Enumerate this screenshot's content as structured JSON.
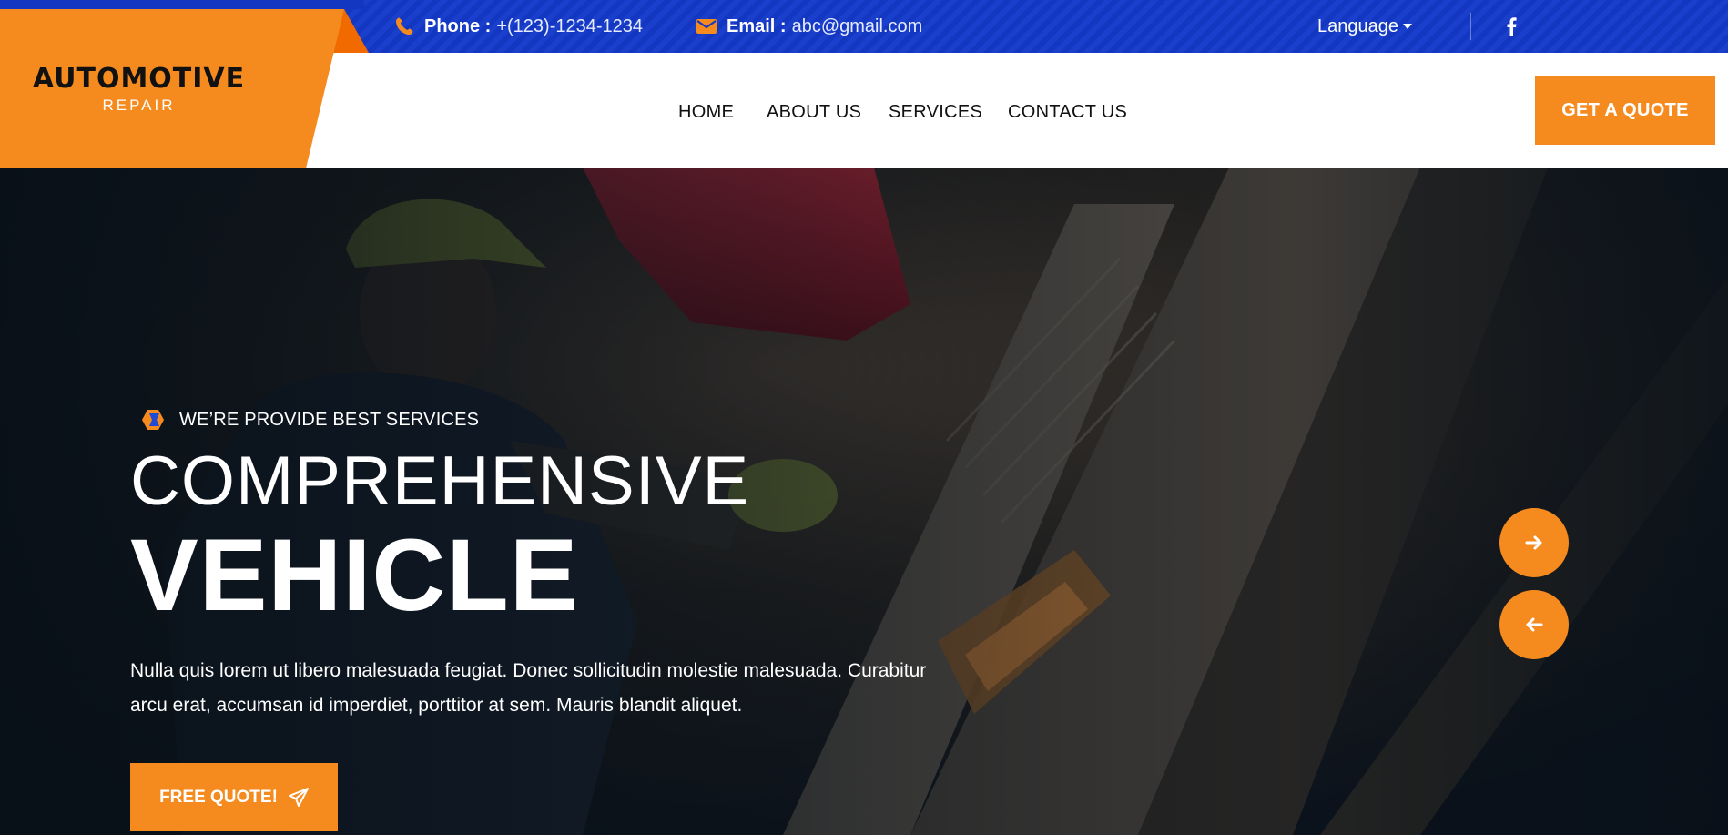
{
  "colors": {
    "accent": "#f58b1f",
    "topbar": "#1437c2",
    "nav_bg": "#ffffff"
  },
  "topbar": {
    "phone_label": "Phone :",
    "phone_value": "+(123)-1234-1234",
    "email_label": "Email :",
    "email_value": "abc@gmail.com",
    "language": "Language",
    "icons": [
      "phone-icon",
      "envelope-icon",
      "caret-down-icon",
      "facebook-icon"
    ]
  },
  "logo": {
    "main": "AUTOMOTIVE",
    "sub": "REPAIR"
  },
  "nav": {
    "items": [
      {
        "label": "HOME"
      },
      {
        "label": "ABOUT US"
      },
      {
        "label": "SERVICES"
      },
      {
        "label": "CONTACT US"
      }
    ],
    "cta": "GET A QUOTE"
  },
  "hero": {
    "tagline": "WE’RE PROVIDE BEST SERVICES",
    "headline_line1": "COMPREHENSIVE",
    "headline_line2": "VEHICLE",
    "description": "Nulla quis lorem ut libero malesuada feugiat. Donec sollicitudin molestie malesuada. Curabitur arcu erat, accumsan id imperdiet, porttitor at sem. Mauris blandit aliquet.",
    "cta": "FREE QUOTE!",
    "icons": [
      "badge-icon",
      "paper-plane-icon",
      "arrow-right-icon",
      "arrow-left-icon"
    ]
  }
}
